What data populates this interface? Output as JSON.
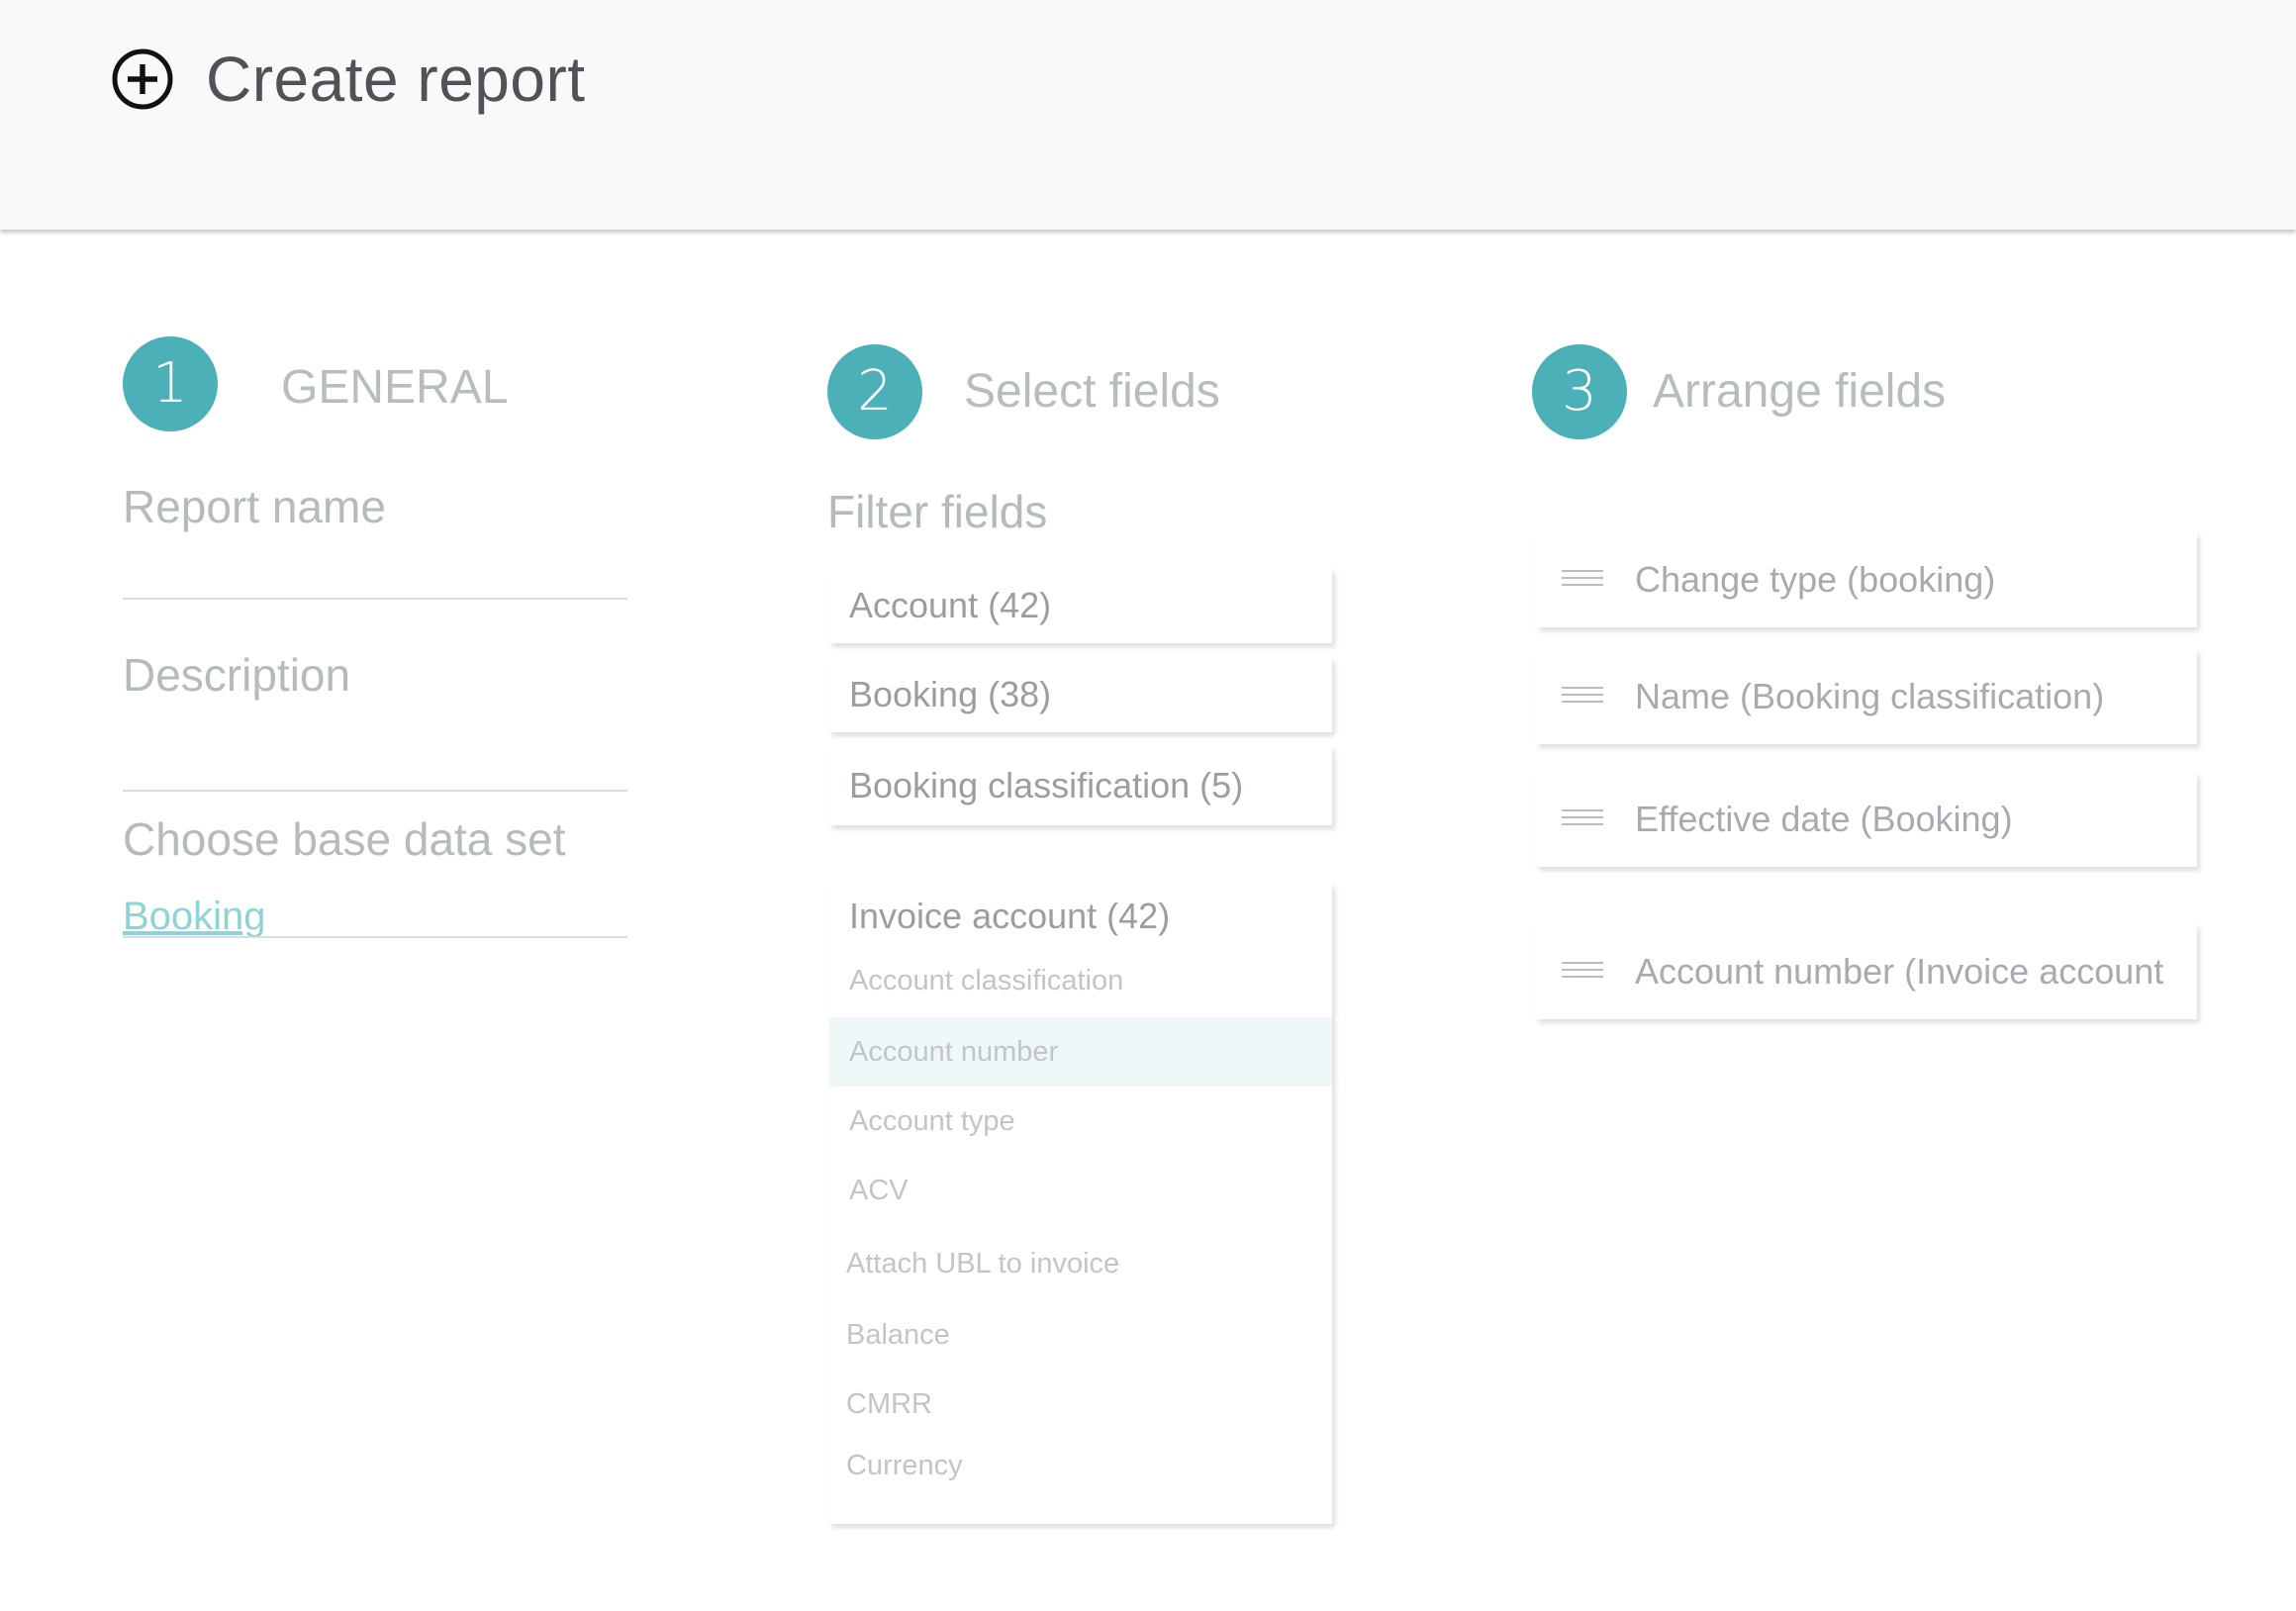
{
  "header": {
    "title": "Create report",
    "icon": "add-circle-icon"
  },
  "steps": [
    {
      "number": "1",
      "title": "GENERAL"
    },
    {
      "number": "2",
      "title": "Select fields"
    },
    {
      "number": "3",
      "title": "Arrange fields"
    }
  ],
  "general": {
    "report_name_label": "Report name",
    "report_name_value": "",
    "description_label": "Description",
    "description_value": "",
    "base_data_set_label": "Choose base data set",
    "base_data_set_value": "Booking"
  },
  "select_fields": {
    "filter_label": "Filter fields",
    "groups": [
      {
        "label": "Account (42)"
      },
      {
        "label": "Booking (38)"
      },
      {
        "label": "Booking classification (5)"
      }
    ],
    "expanded_group": {
      "label": "Invoice account (42)",
      "options": [
        {
          "label": "Account classification",
          "selected": false
        },
        {
          "label": "Account number",
          "selected": true
        },
        {
          "label": "Account type",
          "selected": false
        },
        {
          "label": "ACV",
          "selected": false
        },
        {
          "label": "Attach UBL to invoice",
          "selected": false
        },
        {
          "label": "Balance",
          "selected": false
        },
        {
          "label": "CMRR",
          "selected": false
        },
        {
          "label": "Currency",
          "selected": false
        }
      ]
    }
  },
  "arrange_fields": {
    "items": [
      {
        "label": "Change type (booking)"
      },
      {
        "label": "Name (Booking classification)"
      },
      {
        "label": "Effective date (Booking)"
      },
      {
        "label": "Account number (Invoice account"
      }
    ]
  },
  "colors": {
    "accent": "#4bb0b8",
    "link": "#8fd3d7",
    "selected_row": "#eef8f9",
    "header_bg": "#f9f9f9"
  }
}
